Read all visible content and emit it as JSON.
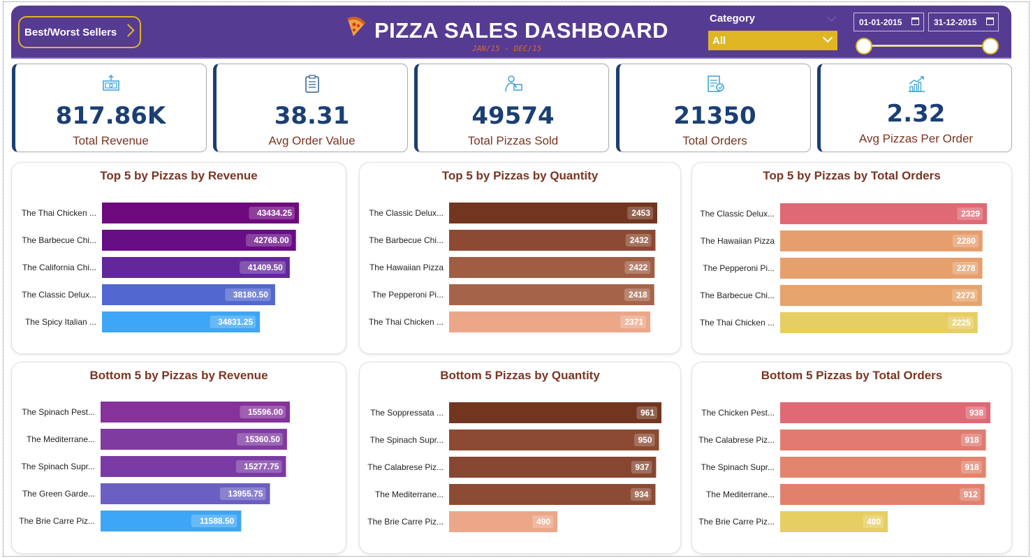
{
  "header": {
    "nav_button_label": "Best/Worst Sellers",
    "title": "PIZZA SALES DASHBOARD",
    "subtitle": "JAN/15 - DEC/15",
    "category_label": "Category",
    "category_value": "All",
    "date_start": "01-01-2015",
    "date_end": "31-12-2015",
    "colors": {
      "bar": "#563b92",
      "accent": "#e0b523",
      "subtitle": "#e0662b"
    }
  },
  "kpis": [
    {
      "value": "817.86K",
      "label": "Total Revenue",
      "icon": "money-icon"
    },
    {
      "value": "38.31",
      "label": "Avg Order Value",
      "icon": "clipboard-icon"
    },
    {
      "value": "49574",
      "label": "Total Pizzas Sold",
      "icon": "delivery-person-icon"
    },
    {
      "value": "21350",
      "label": "Total Orders",
      "icon": "order-list-icon"
    },
    {
      "value": "2.32",
      "label": "Avg Pizzas Per Order",
      "icon": "growth-chart-icon"
    }
  ],
  "chart_data": [
    {
      "type": "bar",
      "orientation": "horizontal",
      "title": "Top 5 by Pizzas by Revenue",
      "categories": [
        "The Thai Chicken ...",
        "The Barbecue Chi...",
        "The California Chi...",
        "The Classic Delux...",
        "The Spicy Italian ..."
      ],
      "values": [
        43434.25,
        42768.0,
        41409.5,
        38180.5,
        34831.25
      ],
      "value_labels": [
        "43434.25",
        "42768.00",
        "41409.50",
        "38180.50",
        "34831.25"
      ],
      "colors": [
        "#6f0a7e",
        "#670d85",
        "#63279b",
        "#5267cf",
        "#3ea6f6"
      ]
    },
    {
      "type": "bar",
      "orientation": "horizontal",
      "title": "Top 5 by Pizzas by Quantity",
      "categories": [
        "The Classic Delux...",
        "The Barbecue Chi...",
        "The Hawaiian Pizza",
        "The Pepperoni Pi...",
        "The Thai Chicken ..."
      ],
      "values": [
        2453,
        2432,
        2422,
        2418,
        2371
      ],
      "value_labels": [
        "2453",
        "2432",
        "2422",
        "2418",
        "2371"
      ],
      "colors": [
        "#723620",
        "#8c4a32",
        "#a05d43",
        "#a5644a",
        "#eca788"
      ]
    },
    {
      "type": "bar",
      "orientation": "horizontal",
      "title": "Top 5 by Pizzas by Total Orders",
      "categories": [
        "The Classic Delux...",
        "The Hawaiian Pizza",
        "The Pepperoni Pi...",
        "The Barbecue Chi...",
        "The Thai Chicken ..."
      ],
      "values": [
        2329,
        2280,
        2278,
        2273,
        2225
      ],
      "value_labels": [
        "2329",
        "2280",
        "2278",
        "2273",
        "2225"
      ],
      "colors": [
        "#df6975",
        "#e79e6f",
        "#e6a06e",
        "#e6a36b",
        "#e6ce63"
      ]
    },
    {
      "type": "bar",
      "orientation": "horizontal",
      "title": "Bottom 5 by Pizzas by Revenue",
      "categories": [
        "The Spinach Pest...",
        "The Mediterrane...",
        "The Spinach Supr...",
        "The Green Garde...",
        "The Brie Carre Piz..."
      ],
      "values": [
        15596.0,
        15360.5,
        15277.75,
        13955.75,
        11588.5
      ],
      "value_labels": [
        "15596.00",
        "15360.50",
        "15277.75",
        "13955.75",
        "11588.50"
      ],
      "colors": [
        "#86329b",
        "#7f3ba0",
        "#7a3ba4",
        "#6b5fc2",
        "#3ea6f6"
      ]
    },
    {
      "type": "bar",
      "orientation": "horizontal",
      "title": "Bottom 5 Pizzas by Quantity",
      "categories": [
        "The Soppressata ...",
        "The Spinach Supr...",
        "The Calabrese Piz...",
        "The Mediterrane...",
        "The Brie Carre Piz..."
      ],
      "values": [
        961,
        950,
        937,
        934,
        490
      ],
      "value_labels": [
        "961",
        "950",
        "937",
        "934",
        "490"
      ],
      "colors": [
        "#723620",
        "#8c4a32",
        "#874630",
        "#8c4b33",
        "#eca788"
      ]
    },
    {
      "type": "bar",
      "orientation": "horizontal",
      "title": "Bottom 5 Pizzas by Total Orders",
      "categories": [
        "The Chicken Pest...",
        "The Calabrese Piz...",
        "The Spinach Supr...",
        "The Mediterrane...",
        "The Brie Carre Piz..."
      ],
      "values": [
        938,
        918,
        918,
        912,
        480
      ],
      "value_labels": [
        "938",
        "918",
        "918",
        "912",
        "480"
      ],
      "colors": [
        "#df6975",
        "#e17b71",
        "#e3846f",
        "#e1816c",
        "#e6ce63"
      ]
    }
  ]
}
